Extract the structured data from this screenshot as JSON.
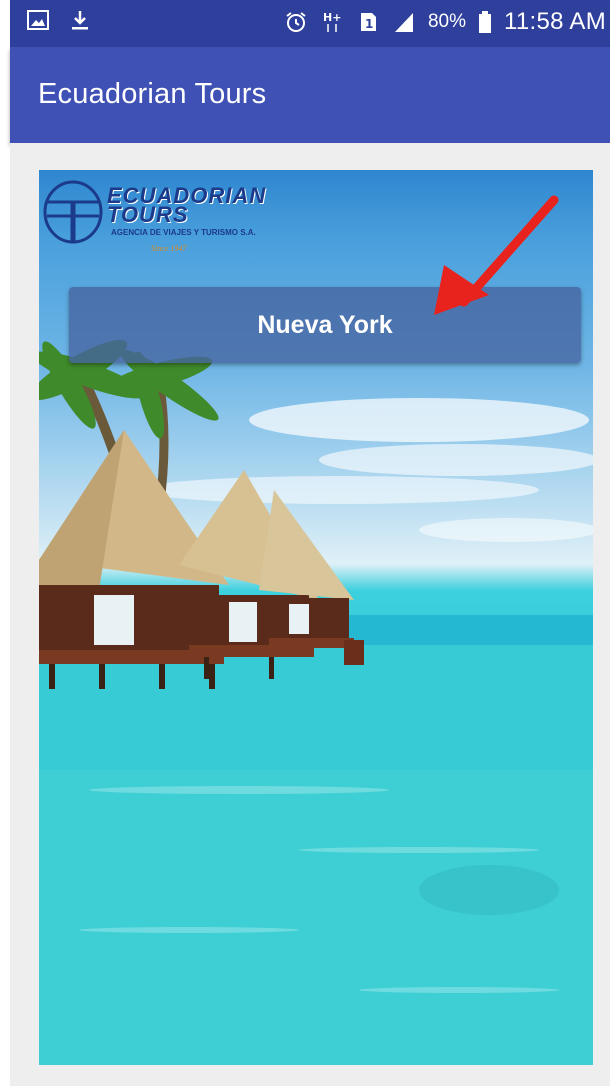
{
  "status_bar": {
    "icons": [
      "image-icon",
      "download-icon",
      "alarm-icon",
      "hplus-network-icon",
      "sim-icon",
      "signal-icon",
      "battery-icon"
    ],
    "battery_percent": "80%",
    "time": "11:58 AM"
  },
  "app_bar": {
    "title": "Ecuadorian Tours"
  },
  "banner": {
    "logo": {
      "line1": "ECUADORIAN",
      "line2": "TOURS",
      "tagline": "AGENCIA DE VIAJES Y TURISMO S.A.",
      "since": "Since 1947"
    },
    "destination_button_label": "Nueva York"
  },
  "annotation": {
    "arrow_color": "#e8231e"
  },
  "colors": {
    "status_bar": "#2f3f9c",
    "app_bar": "#3f51b5",
    "background": "#eeeeee"
  }
}
